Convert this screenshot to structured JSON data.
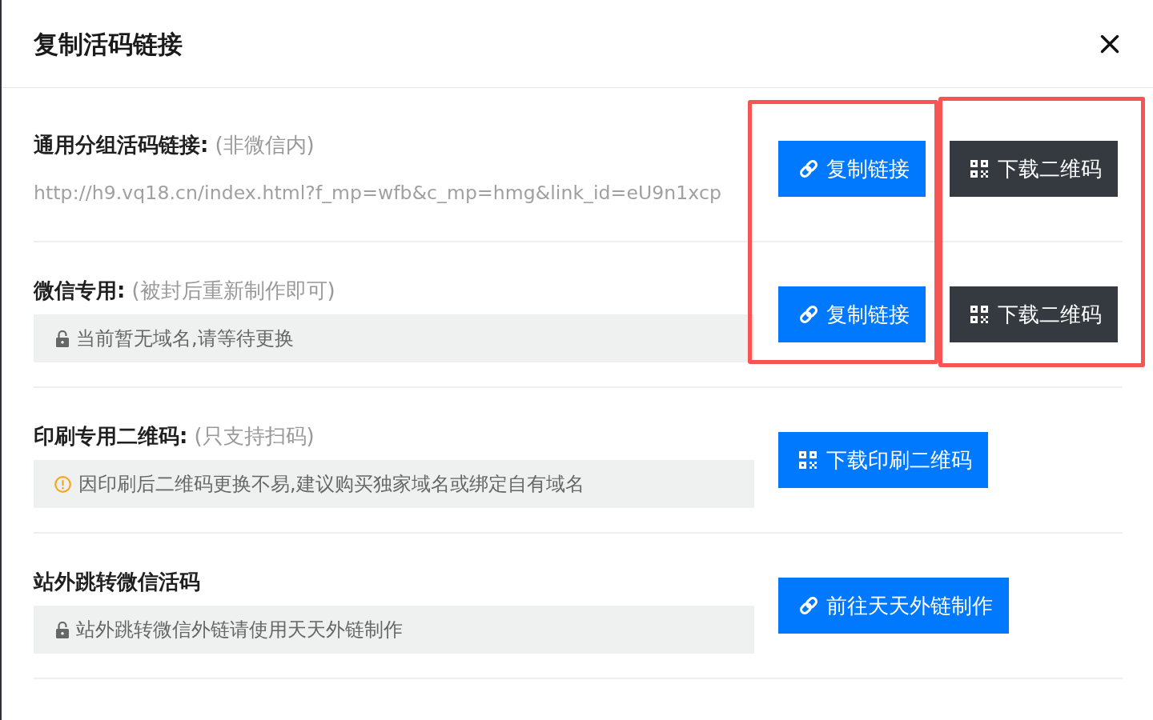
{
  "dialog": {
    "title": "复制活码链接"
  },
  "sections": [
    {
      "label": "通用分组活码链接:",
      "note": "(非微信内)",
      "detail": {
        "kind": "url",
        "text": "http://h9.vq18.cn/index.html?f_mp=wfb&c_mp=hmg&link_id=eU9n1xcp"
      },
      "buttons": [
        {
          "label": "复制链接",
          "kind": "link",
          "highlighted": true
        },
        {
          "label": "下载二维码",
          "kind": "qr",
          "highlighted": true
        }
      ]
    },
    {
      "label": "微信专用:",
      "note": "(被封后重新制作即可)",
      "detail": {
        "kind": "locked",
        "text": "当前暂无域名,请等待更换"
      },
      "buttons": [
        {
          "label": "复制链接",
          "kind": "link",
          "highlighted": true
        },
        {
          "label": "下载二维码",
          "kind": "qr",
          "highlighted": true
        }
      ]
    },
    {
      "label": "印刷专用二维码:",
      "note": "(只支持扫码)",
      "detail": {
        "kind": "warning",
        "text": "因印刷后二维码更换不易,建议购买独家域名或绑定自有域名"
      },
      "buttons": [
        {
          "label": "下载印刷二维码",
          "kind": "qr",
          "highlighted": false
        }
      ]
    },
    {
      "label": "站外跳转微信活码",
      "detail": {
        "kind": "locked",
        "text": "站外跳转微信外链请使用天天外链制作"
      },
      "buttons": [
        {
          "label": "前往天天外链制作",
          "kind": "link",
          "highlighted": false
        }
      ]
    }
  ]
}
